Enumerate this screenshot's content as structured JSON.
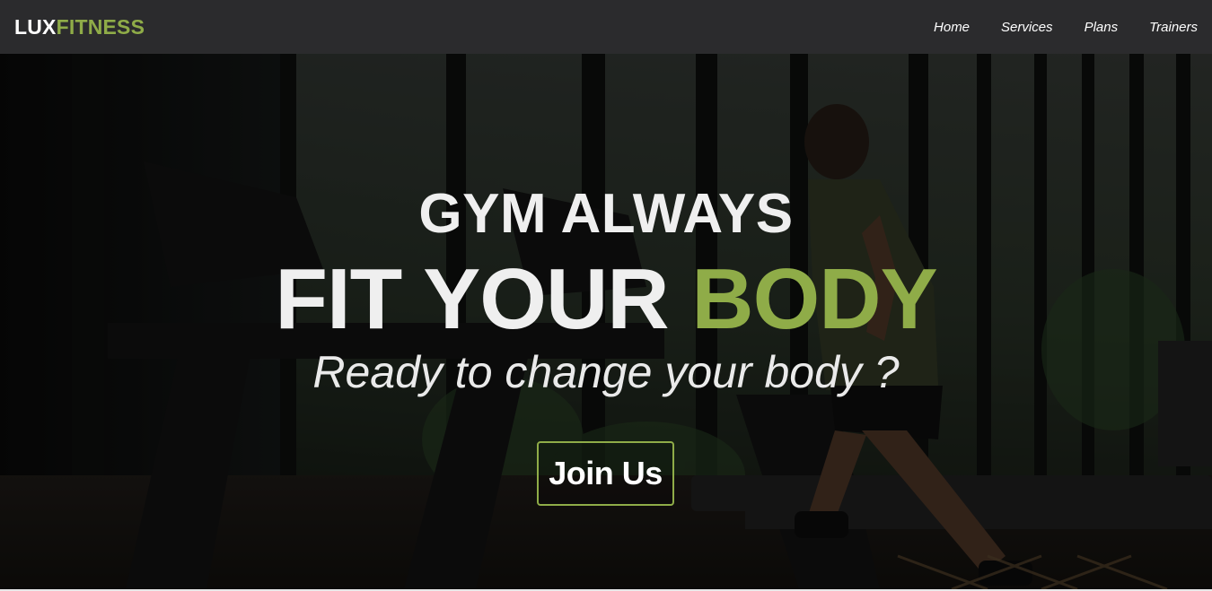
{
  "brand": {
    "part1": "LUX",
    "part2": "FITNESS",
    "accent_color": "#8fac48"
  },
  "nav": {
    "items": [
      {
        "label": "Home"
      },
      {
        "label": "Services"
      },
      {
        "label": "Plans"
      },
      {
        "label": "Trainers"
      }
    ]
  },
  "hero": {
    "line1": "GYM ALWAYS",
    "line2_white": "FIT YOUR",
    "line2_accent": "BODY",
    "subtitle": "Ready to change your body ?",
    "cta_label": "Join Us",
    "background": "gym-treadmill-runner-photo"
  }
}
